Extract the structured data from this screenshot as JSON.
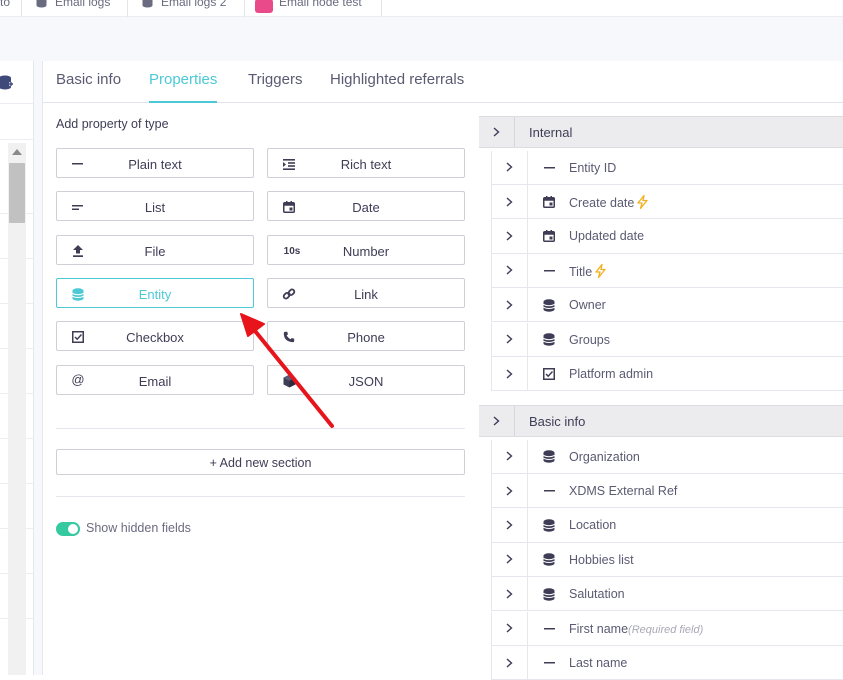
{
  "top_tabs": [
    {
      "label": "to"
    },
    {
      "label": "Email logs",
      "icon": "database-icon"
    },
    {
      "label": "Email logs 2",
      "icon": "database-icon"
    },
    {
      "label": "Email node test",
      "icon": "pink-square-icon"
    }
  ],
  "tabs": [
    {
      "label": "Basic info"
    },
    {
      "label": "Properties"
    },
    {
      "label": "Triggers"
    },
    {
      "label": "Highlighted referrals"
    }
  ],
  "active_tab": "Properties",
  "add_property_label": "Add property of type",
  "property_types": [
    {
      "label": "Plain text",
      "icon": "dash-icon"
    },
    {
      "label": "Rich text",
      "icon": "indent-icon"
    },
    {
      "label": "List",
      "icon": "list-lines-icon"
    },
    {
      "label": "Date",
      "icon": "calendar-icon"
    },
    {
      "label": "File",
      "icon": "upload-icon"
    },
    {
      "label": "Number",
      "icon": "10s-icon"
    },
    {
      "label": "Entity",
      "icon": "database-icon"
    },
    {
      "label": "Link",
      "icon": "link-icon"
    },
    {
      "label": "Checkbox",
      "icon": "checkbox-icon"
    },
    {
      "label": "Phone",
      "icon": "phone-icon"
    },
    {
      "label": "Email",
      "icon": "at-icon"
    },
    {
      "label": "JSON",
      "icon": "cube-icon"
    }
  ],
  "number_icon_text": "10s",
  "email_icon_text": "@",
  "add_section_label": "+ Add new section",
  "show_hidden_label": "Show hidden fields",
  "show_hidden_on": true,
  "sections": [
    {
      "title": "Internal",
      "fields": [
        {
          "label": "Entity ID",
          "icon": "dash-icon"
        },
        {
          "label": "Create date",
          "icon": "calendar-icon",
          "bolt": true
        },
        {
          "label": "Updated date",
          "icon": "calendar-icon"
        },
        {
          "label": "Title",
          "icon": "dash-icon",
          "bolt": true
        },
        {
          "label": "Owner",
          "icon": "database-icon"
        },
        {
          "label": "Groups",
          "icon": "database-icon"
        },
        {
          "label": "Platform admin",
          "icon": "checkbox-icon"
        }
      ]
    },
    {
      "title": "Basic info",
      "fields": [
        {
          "label": "Organization",
          "icon": "database-icon"
        },
        {
          "label": "XDMS External Ref",
          "icon": "dash-icon"
        },
        {
          "label": "Location",
          "icon": "database-icon"
        },
        {
          "label": "Hobbies list",
          "icon": "database-icon"
        },
        {
          "label": "Salutation",
          "icon": "database-icon"
        },
        {
          "label": "First name",
          "icon": "dash-icon",
          "note": "(Required field)"
        },
        {
          "label": "Last name",
          "icon": "dash-icon"
        }
      ]
    }
  ],
  "colors": {
    "accent": "#4dc9d6",
    "toggle": "#35c9a0",
    "arrow": "#e8141b",
    "bolt": "#f2b01e"
  }
}
